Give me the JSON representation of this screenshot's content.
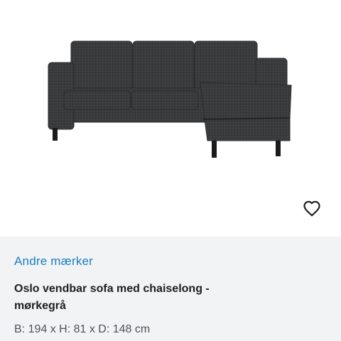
{
  "listing": {
    "brand": "Andre mærker",
    "title": "Oslo vendbar sofa med chaiselong - mørkegrå",
    "dimensions": "B: 194 x H: 81 x D: 148 cm"
  },
  "icons": {
    "favorite": "heart-outline-icon"
  },
  "colors": {
    "brand_link": "#1a7fc1",
    "info_background": "#f2f3f5",
    "sofa_fabric": "#3a3b3d"
  }
}
